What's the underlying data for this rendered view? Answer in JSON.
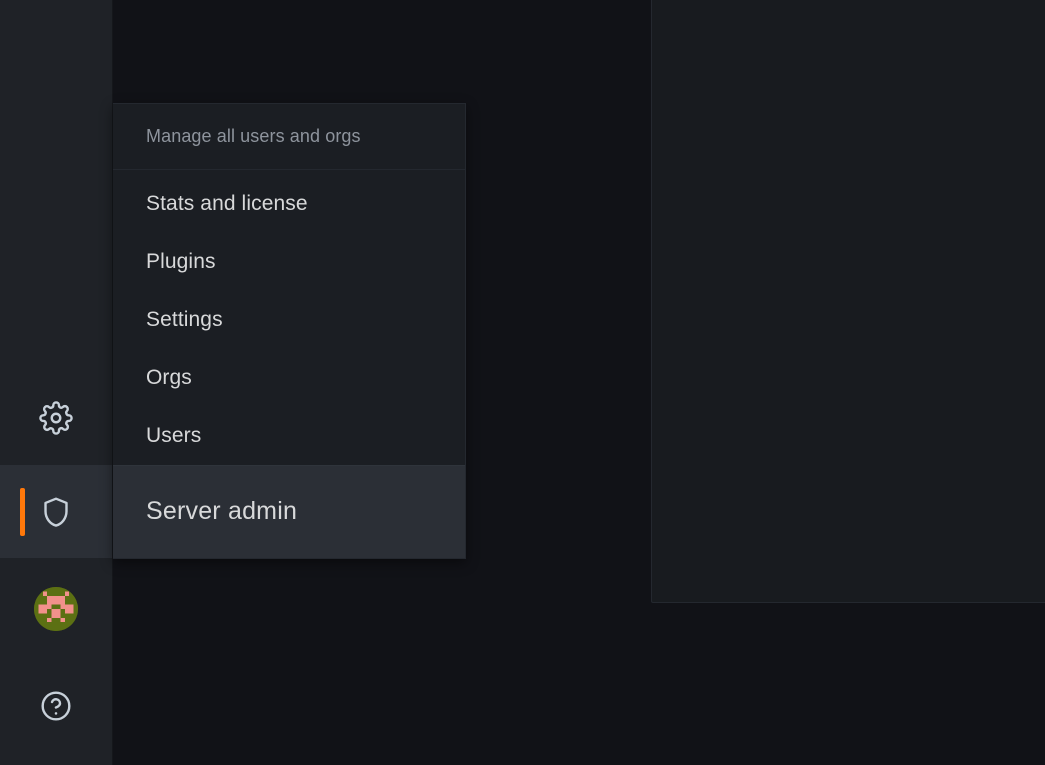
{
  "theme": {
    "sidebar_bg": "#1f2227",
    "content_bg": "#111217",
    "panel_bg": "#181b1f",
    "menu_bg": "#1b1e23",
    "menu_active_bg": "#2b2f36",
    "accent": "#ff780a",
    "text_primary": "#d8d9da",
    "text_muted": "#8e949d",
    "border": "#24282f"
  },
  "sidebar": {
    "items": [
      {
        "id": "configuration",
        "icon": "gear-icon",
        "active": false
      },
      {
        "id": "server-admin",
        "icon": "shield-icon",
        "active": true
      },
      {
        "id": "user-profile",
        "icon": "avatar-icon",
        "active": false
      },
      {
        "id": "help",
        "icon": "help-circle-icon",
        "active": false
      }
    ]
  },
  "flyout": {
    "header": "Manage all users and orgs",
    "items": [
      {
        "label": "Stats and license"
      },
      {
        "label": "Plugins"
      },
      {
        "label": "Settings"
      },
      {
        "label": "Orgs"
      },
      {
        "label": "Users"
      }
    ],
    "footer": {
      "label": "Server admin",
      "active": true
    }
  }
}
